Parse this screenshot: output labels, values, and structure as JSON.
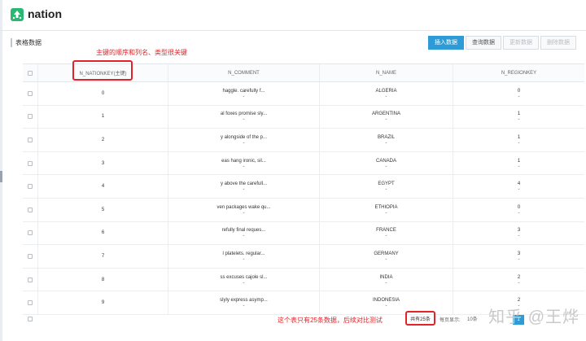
{
  "app": {
    "title": "nation",
    "logo_icon": "upload-arrow-icon",
    "logo_color": "#2bb673"
  },
  "section_title": "表格数据",
  "toolbar": {
    "insert": "插入数据",
    "query": "查询数据",
    "update": "更新数据",
    "delete": "删除数据"
  },
  "annotations": {
    "top": "主键的顺序和列名、类型很关键",
    "bottom": "这个表只有25条数据，后续对比测试",
    "accent_color": "#e0242a"
  },
  "table": {
    "headers": [
      "N_NATIONKEY(主键)",
      "N_COMMENT",
      "N_NAME",
      "N_REGIONKEY"
    ],
    "rows": [
      [
        "0",
        "haggle. carefully f...",
        "ALGERIA",
        "0"
      ],
      [
        "1",
        "al foxes promise sly...",
        "ARGENTINA",
        "1"
      ],
      [
        "2",
        "y alongside of the p...",
        "BRAZIL",
        "1"
      ],
      [
        "3",
        "eas hang ironic, sil...",
        "CANADA",
        "1"
      ],
      [
        "4",
        "y above the carefull...",
        "EGYPT",
        "4"
      ],
      [
        "5",
        "ven packages wake qu...",
        "ETHIOPIA",
        "0"
      ],
      [
        "6",
        "refully final reques...",
        "FRANCE",
        "3"
      ],
      [
        "7",
        "l platelets. regular...",
        "GERMANY",
        "3"
      ],
      [
        "8",
        "ss excuses cajole sl...",
        "INDIA",
        "2"
      ],
      [
        "9",
        "slyly express asymp...",
        "INDONESIA",
        "2"
      ]
    ]
  },
  "pagination": {
    "total": "共有25条",
    "per_page_label": "每页显示:",
    "per_page_value": "10条",
    "current_page": "1"
  },
  "watermark": "知乎 @王烨",
  "colors": {
    "primary": "#2e9bd6"
  }
}
